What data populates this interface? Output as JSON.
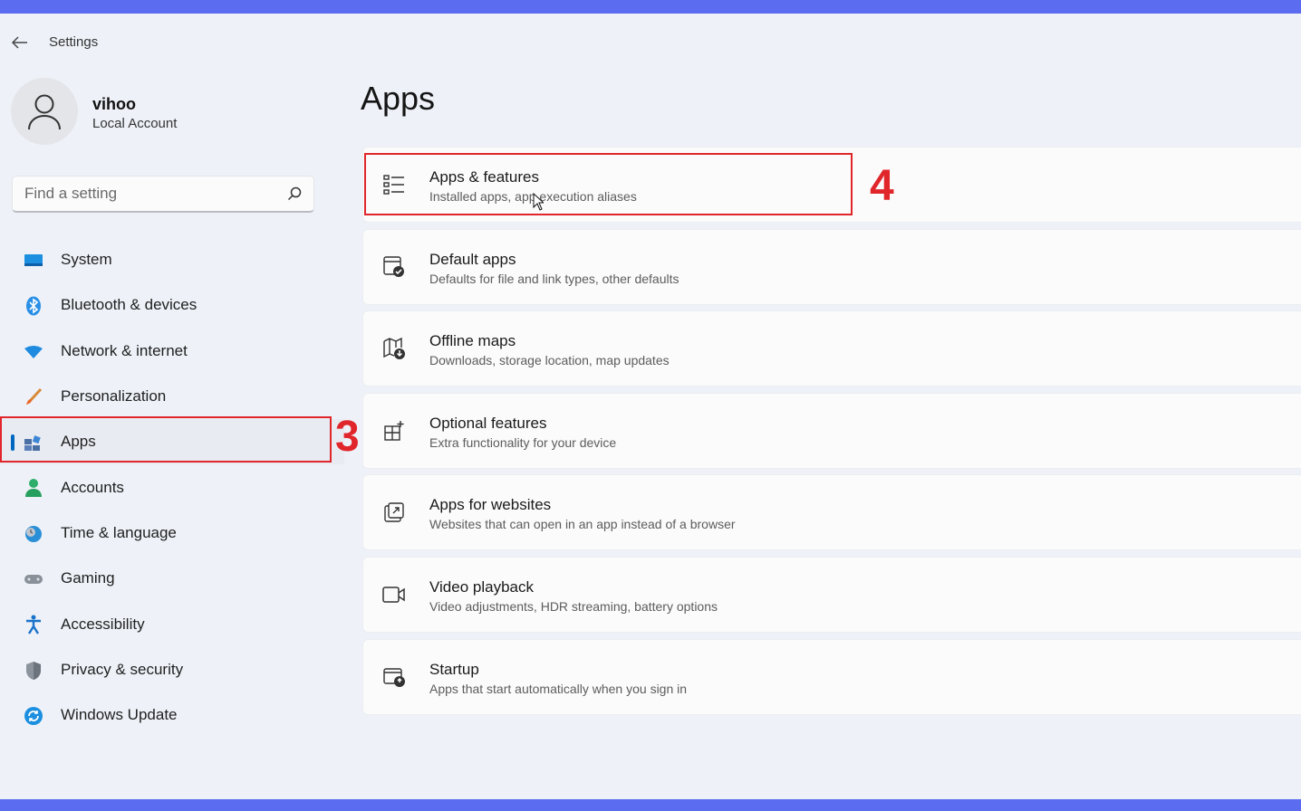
{
  "window": {
    "title": "Settings"
  },
  "profile": {
    "name": "vihoo",
    "account_type": "Local Account"
  },
  "search": {
    "placeholder": "Find a setting"
  },
  "sidebar": {
    "items": [
      {
        "label": "System",
        "icon": "system-icon"
      },
      {
        "label": "Bluetooth & devices",
        "icon": "bluetooth-icon"
      },
      {
        "label": "Network & internet",
        "icon": "wifi-icon"
      },
      {
        "label": "Personalization",
        "icon": "brush-icon"
      },
      {
        "label": "Apps",
        "icon": "apps-icon",
        "active": true
      },
      {
        "label": "Accounts",
        "icon": "person-icon"
      },
      {
        "label": "Time & language",
        "icon": "globe-clock-icon"
      },
      {
        "label": "Gaming",
        "icon": "gamepad-icon"
      },
      {
        "label": "Accessibility",
        "icon": "accessibility-icon"
      },
      {
        "label": "Privacy & security",
        "icon": "shield-icon"
      },
      {
        "label": "Windows Update",
        "icon": "update-icon"
      }
    ]
  },
  "main": {
    "title": "Apps",
    "cards": [
      {
        "title": "Apps & features",
        "subtitle": "Installed apps, app execution aliases",
        "icon": "list-icon"
      },
      {
        "title": "Default apps",
        "subtitle": "Defaults for file and link types, other defaults",
        "icon": "default-apps-icon"
      },
      {
        "title": "Offline maps",
        "subtitle": "Downloads, storage location, map updates",
        "icon": "map-icon"
      },
      {
        "title": "Optional features",
        "subtitle": "Extra functionality for your device",
        "icon": "add-grid-icon"
      },
      {
        "title": "Apps for websites",
        "subtitle": "Websites that can open in an app instead of a browser",
        "icon": "open-external-icon"
      },
      {
        "title": "Video playback",
        "subtitle": "Video adjustments, HDR streaming, battery options",
        "icon": "video-camera-icon"
      },
      {
        "title": "Startup",
        "subtitle": "Apps that start automatically when you sign in",
        "icon": "startup-icon"
      }
    ]
  },
  "annotations": {
    "step_3": "3",
    "step_4": "4"
  },
  "colors": {
    "accent": "#0067c0",
    "annotation": "#e0262b",
    "frame": "#5b6cf0"
  }
}
